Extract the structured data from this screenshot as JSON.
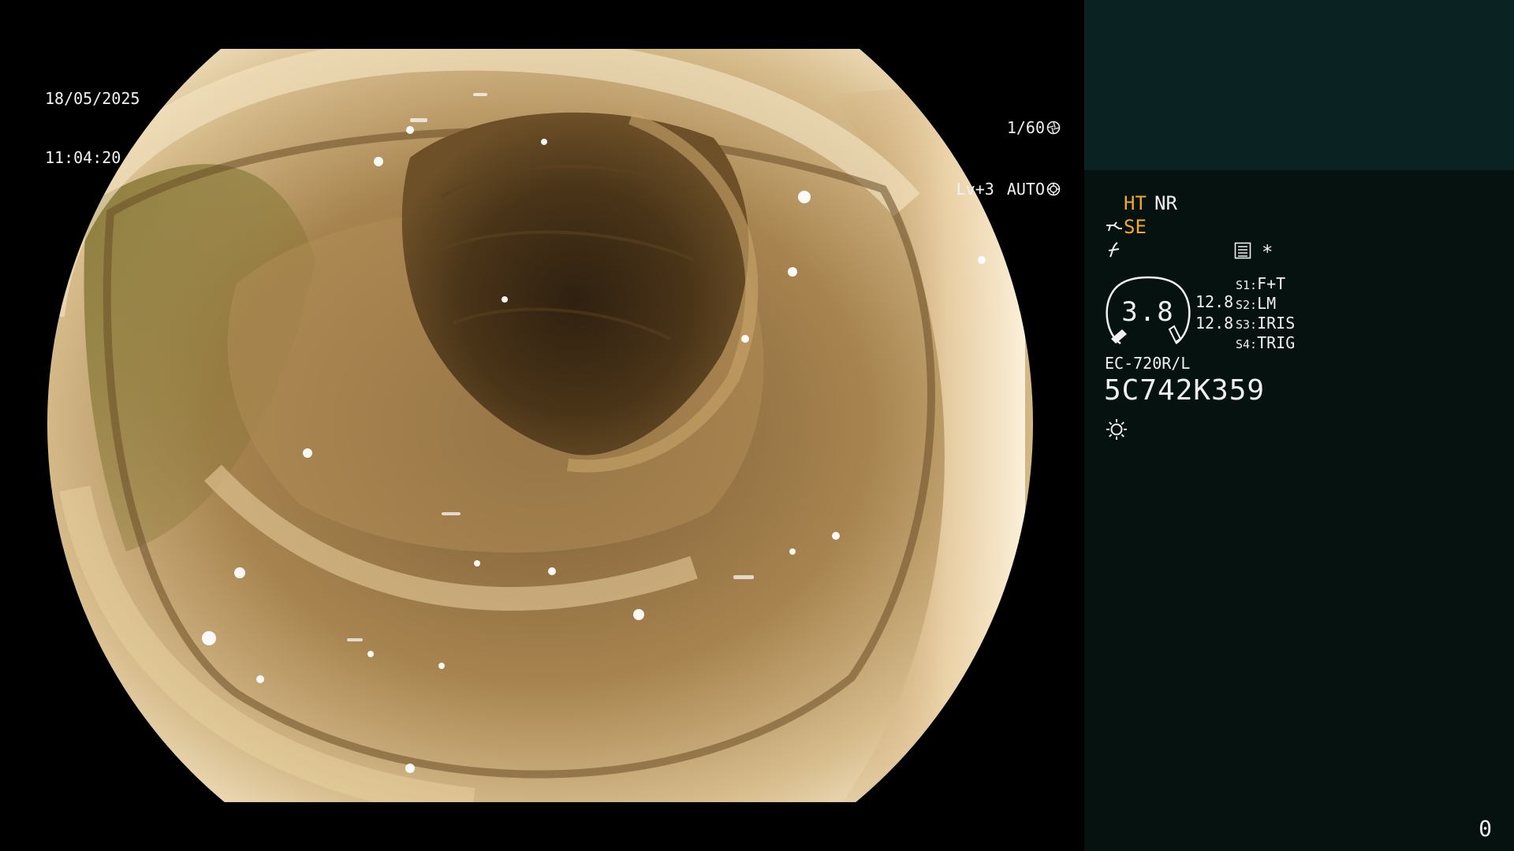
{
  "overlay": {
    "date": "18/05/2025",
    "time": "11:04:20",
    "shutter_speed": "1/60",
    "level": "Lv+3",
    "mode": "AUTO"
  },
  "panel": {
    "mode_ht": "HT",
    "mode_nr": "NR",
    "mode_se": "SE",
    "star": "*",
    "gauge_value": "3.8",
    "gauge_side_1": "12.8",
    "gauge_side_2": "12.8",
    "switches": [
      {
        "key": "S1:",
        "value": "F+T"
      },
      {
        "key": "S2:",
        "value": "LM"
      },
      {
        "key": "S3:",
        "value": "IRIS"
      },
      {
        "key": "S4:",
        "value": "TRIG"
      }
    ],
    "scope_model": "EC-720R/L",
    "scope_serial": "5C742K359",
    "corner_number": "0"
  },
  "icons": {
    "shutter": "aperture-icon",
    "auto": "auto-iris-icon",
    "pump": "water-pump-icon",
    "freeze": "freeze-icon",
    "menu": "menu-icon",
    "light": "light-icon"
  },
  "colors": {
    "accent": "#f0ab2a",
    "panel_bg": "#051210",
    "panel_top_bg": "#0b2222"
  }
}
